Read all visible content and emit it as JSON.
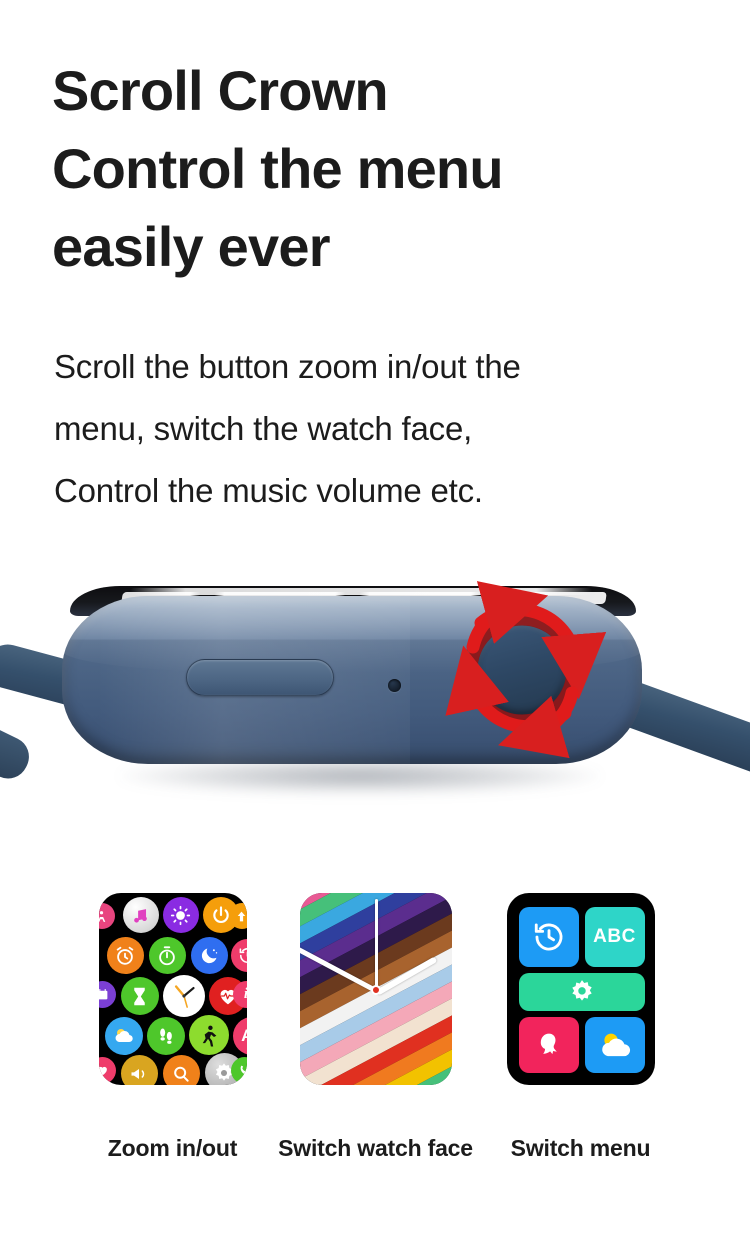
{
  "headline": {
    "lines": [
      "Scroll Crown",
      "Control the menu",
      "easily ever"
    ]
  },
  "subtitle": {
    "lines": [
      "Scroll the button zoom in/out the",
      "menu, switch the watch face,",
      "Control the music volume etc."
    ]
  },
  "hero": {
    "product_name": "smartwatch-side-view",
    "case_color": "#4a6384",
    "strap_color": "#35506c",
    "crown_highlight_color": "#d81f1f",
    "annotation": "rotate-crown-arrows"
  },
  "features": [
    {
      "id": "zoom-in-out",
      "caption": "Zoom in/out",
      "screen_type": "app-grid",
      "apps": [
        {
          "name": "workout-icon",
          "color": "#e8457f",
          "glyph": "person"
        },
        {
          "name": "music-icon",
          "color": "#e6e6e6",
          "glyph": "note"
        },
        {
          "name": "brightness-icon",
          "color": "#8a2be2",
          "glyph": "sun"
        },
        {
          "name": "power-icon",
          "color": "#f59e0b",
          "glyph": "power"
        },
        {
          "name": "upload-icon",
          "color": "#f59e0b",
          "glyph": "arrow-up"
        },
        {
          "name": "alarm-icon",
          "color": "#f0811a",
          "glyph": "alarm"
        },
        {
          "name": "stopwatch-icon",
          "color": "#4ec72b",
          "glyph": "stopwatch"
        },
        {
          "name": "sleep-icon",
          "color": "#2f6ef0",
          "glyph": "moon"
        },
        {
          "name": "history-icon",
          "color": "#ef3c6b",
          "glyph": "history"
        },
        {
          "name": "calendar-icon",
          "color": "#7b3fd4",
          "glyph": "calendar"
        },
        {
          "name": "timer-icon",
          "color": "#4ec72b",
          "glyph": "hourglass"
        },
        {
          "name": "clock-icon",
          "color": "#ffffff",
          "glyph": "clock-face"
        },
        {
          "name": "heart-rate-icon",
          "color": "#e02020",
          "glyph": "heart-pulse"
        },
        {
          "name": "info-icon",
          "color": "#ef3c6b",
          "glyph": "info"
        },
        {
          "name": "weather-icon",
          "color": "#35a8f0",
          "glyph": "cloud-sun"
        },
        {
          "name": "steps-icon",
          "color": "#4ec72b",
          "glyph": "footsteps"
        },
        {
          "name": "run-icon",
          "color": "#8ddc2e",
          "glyph": "runner"
        },
        {
          "name": "text-size-icon",
          "color": "#ef3c6b",
          "glyph": "Aa"
        },
        {
          "name": "favorites-icon",
          "color": "#ef3c6b",
          "glyph": "heart"
        },
        {
          "name": "find-phone-icon",
          "color": "#d9a520",
          "glyph": "megaphone"
        },
        {
          "name": "search-icon",
          "color": "#f0811a",
          "glyph": "magnifier"
        },
        {
          "name": "settings-icon",
          "color": "#b9b9b9",
          "glyph": "gear"
        },
        {
          "name": "phone-icon",
          "color": "#4ec72b",
          "glyph": "phone"
        }
      ]
    },
    {
      "id": "switch-watch-face",
      "caption": "Switch watch face",
      "screen_type": "rainbow-watch-face",
      "stripe_colors": [
        "#f2c200",
        "#f07a1f",
        "#e03020",
        "#e85a94",
        "#46c07a",
        "#3aa8e0",
        "#2f3f9e",
        "#5b2d8e",
        "#2e1a4a",
        "#6b3a1e",
        "#a8632e",
        "#f2f2f2",
        "#a8cbe8",
        "#f4a8b8",
        "#f2e2d0",
        "#e03020",
        "#f07a1f",
        "#f2c200",
        "#46c07a",
        "#3aa8e0",
        "#2f3f9e",
        "#5b2d8e",
        "#6b3a1e",
        "#3a2418"
      ],
      "hands": {
        "hour": "10",
        "minute": "10"
      }
    },
    {
      "id": "switch-menu",
      "caption": "Switch menu",
      "screen_type": "tile-menu",
      "tiles": [
        {
          "name": "history-tile",
          "color": "#1d9bf5",
          "glyph": "history"
        },
        {
          "name": "abc-tile",
          "color": "#2ed5c8",
          "glyph": "ABC",
          "label": "ABC"
        },
        {
          "name": "settings-tile",
          "color": "#2bd69a",
          "glyph": "gear"
        },
        {
          "name": "contact-tile",
          "color": "#f2245c",
          "glyph": "woman"
        },
        {
          "name": "weather-tile",
          "color": "#1d9bf5",
          "glyph": "cloud-sun"
        }
      ]
    }
  ]
}
